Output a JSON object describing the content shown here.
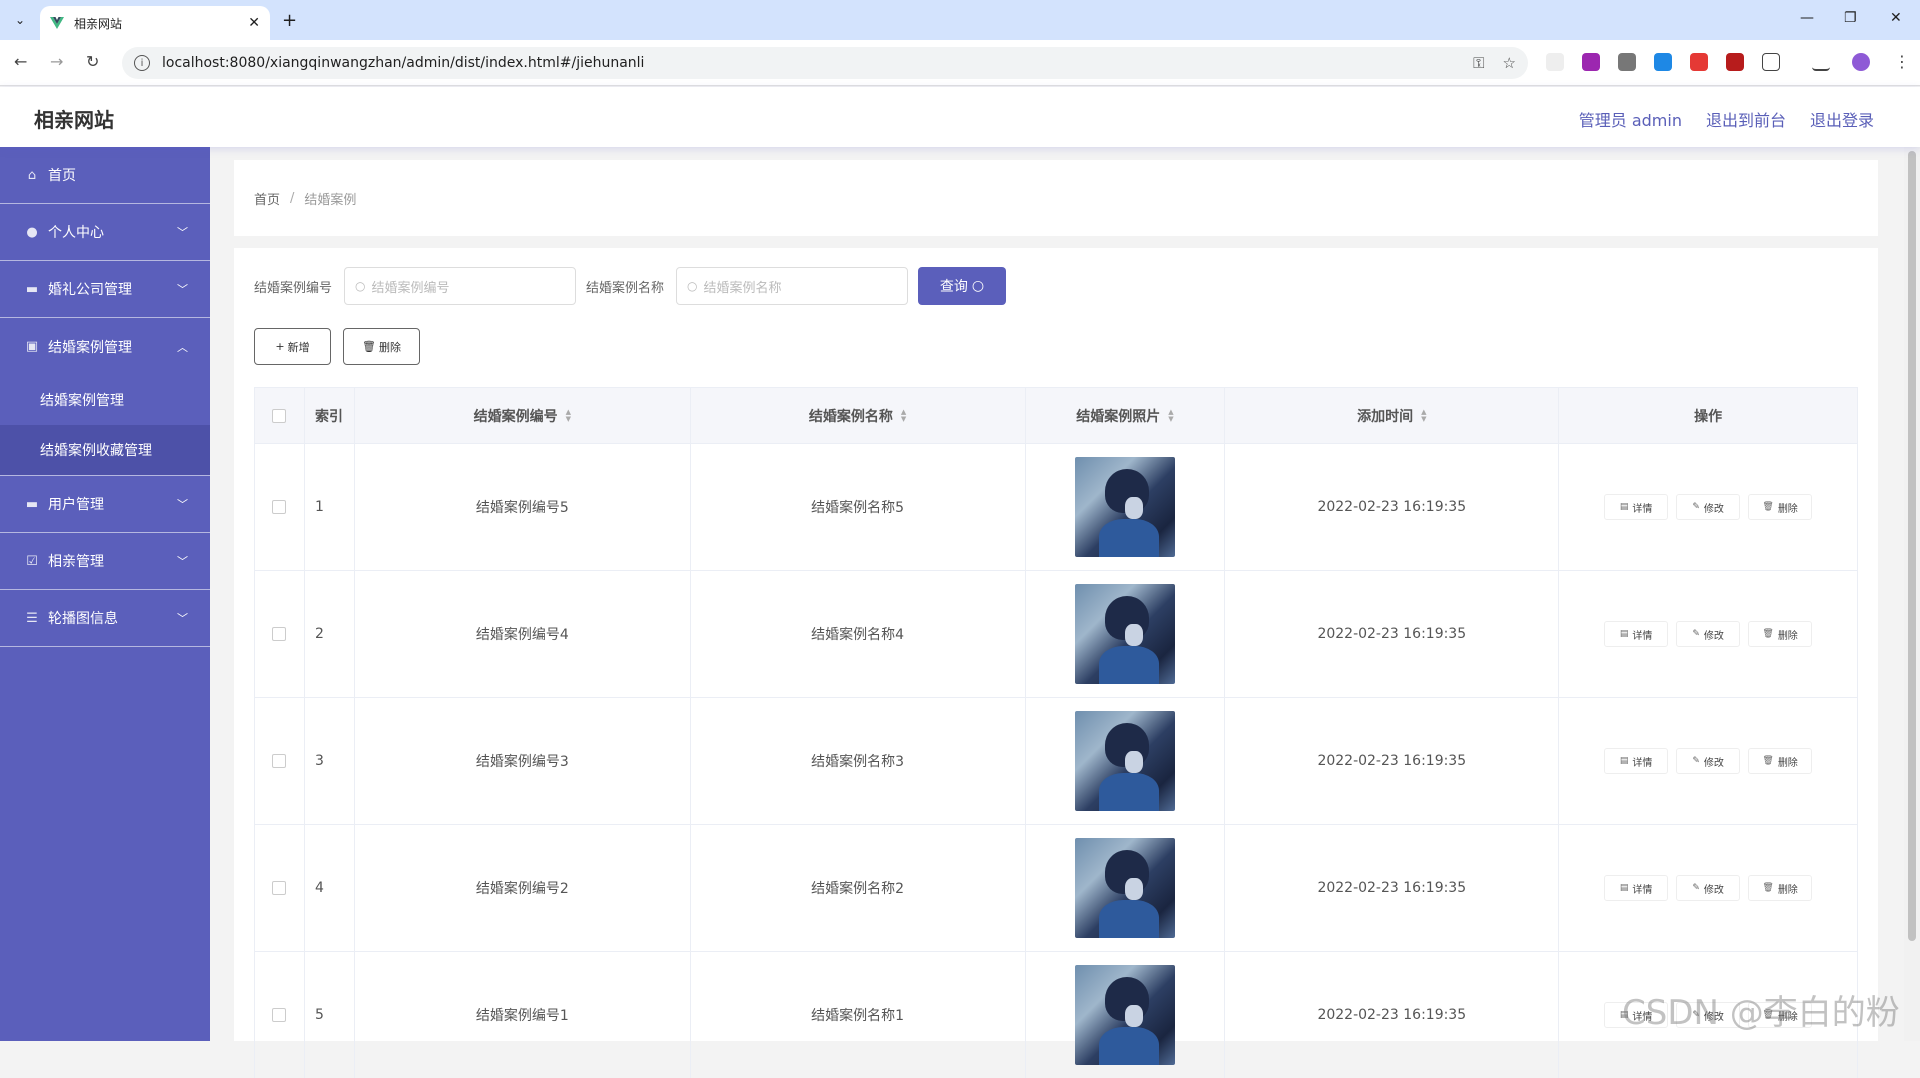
{
  "browser": {
    "tab_title": "相亲网站",
    "url": "localhost:8080/xiangqinwangzhan/admin/dist/index.html#/jiehunanli"
  },
  "header": {
    "brand": "相亲网站",
    "links": [
      "管理员 admin",
      "退出到前台",
      "退出登录"
    ]
  },
  "sidebar": {
    "items": [
      {
        "label": "首页",
        "icon": "home-icon"
      },
      {
        "label": "个人中心",
        "icon": "user-icon"
      },
      {
        "label": "婚礼公司管理",
        "icon": "briefcase-icon"
      },
      {
        "label": "结婚案例管理",
        "icon": "document-icon"
      },
      {
        "label": "用户管理",
        "icon": "folder-icon"
      },
      {
        "label": "相亲管理",
        "icon": "check-icon"
      },
      {
        "label": "轮播图信息",
        "icon": "list-icon"
      }
    ],
    "submenu": [
      "结婚案例管理",
      "结婚案例收藏管理"
    ]
  },
  "breadcrumb": {
    "home": "首页",
    "separator": "/",
    "current": "结婚案例"
  },
  "search": {
    "label_no": "结婚案例编号",
    "placeholder_no": "结婚案例编号",
    "label_name": "结婚案例名称",
    "placeholder_name": "结婚案例名称",
    "query_label": "查询"
  },
  "actions": {
    "add_label": "新增",
    "delete_label": "删除"
  },
  "table": {
    "headers": {
      "index": "索引",
      "no": "结婚案例编号",
      "name": "结婚案例名称",
      "photo": "结婚案例照片",
      "time": "添加时间",
      "op": "操作"
    },
    "op_labels": {
      "detail": "详情",
      "edit": "修改",
      "delete": "删除"
    },
    "rows": [
      {
        "index": "1",
        "no": "结婚案例编号5",
        "name": "结婚案例名称5",
        "time": "2022-02-23 16:19:35"
      },
      {
        "index": "2",
        "no": "结婚案例编号4",
        "name": "结婚案例名称4",
        "time": "2022-02-23 16:19:35"
      },
      {
        "index": "3",
        "no": "结婚案例编号3",
        "name": "结婚案例名称3",
        "time": "2022-02-23 16:19:35"
      },
      {
        "index": "4",
        "no": "结婚案例编号2",
        "name": "结婚案例名称2",
        "time": "2022-02-23 16:19:35"
      },
      {
        "index": "5",
        "no": "结婚案例编号1",
        "name": "结婚案例名称1",
        "time": "2022-02-23 16:19:35"
      }
    ]
  },
  "watermark": "CSDN @李白的粉",
  "colors": {
    "accent": "#5b5fbb",
    "sidebar_active": "#4d51a8"
  }
}
